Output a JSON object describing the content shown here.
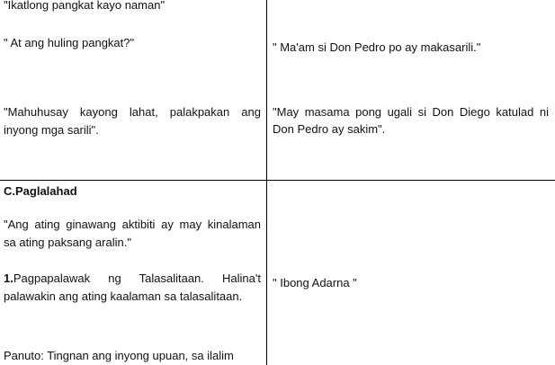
{
  "document": {
    "top_left": {
      "line1": "\"Ikatlong pangkat kayo naman\"",
      "line2": "\" At ang huling pangkat?\"",
      "line3a": "\"Mahuhusay kayong lahat, palakpakan ang",
      "line3b": "inyong mga sarili\"."
    },
    "top_right": {
      "line1": "\" Ma'am si Don Pedro po ay makasarili.\"",
      "line2a": "\"May masama pong ugali si Don Diego katulad ni",
      "line2b": "Don Pedro ay sakim\"."
    },
    "bottom_left": {
      "heading": "C.Paglalahad",
      "para1a": "\"Ang ating ginawang aktibiti ay may kinalaman",
      "para1b": "sa ating paksang aralin.\"",
      "item_number": "1.",
      "item_text_a": "Pagpapalawak ng Talasalitaan. Halina't",
      "item_text_b": "palawakin ang ating kaalaman sa talasalitaan.",
      "panuto": "Panuto: Tingnan ang  inyong upuan, sa ilalim"
    },
    "bottom_right": {
      "answer": "\" Ibong Adarna \""
    }
  }
}
